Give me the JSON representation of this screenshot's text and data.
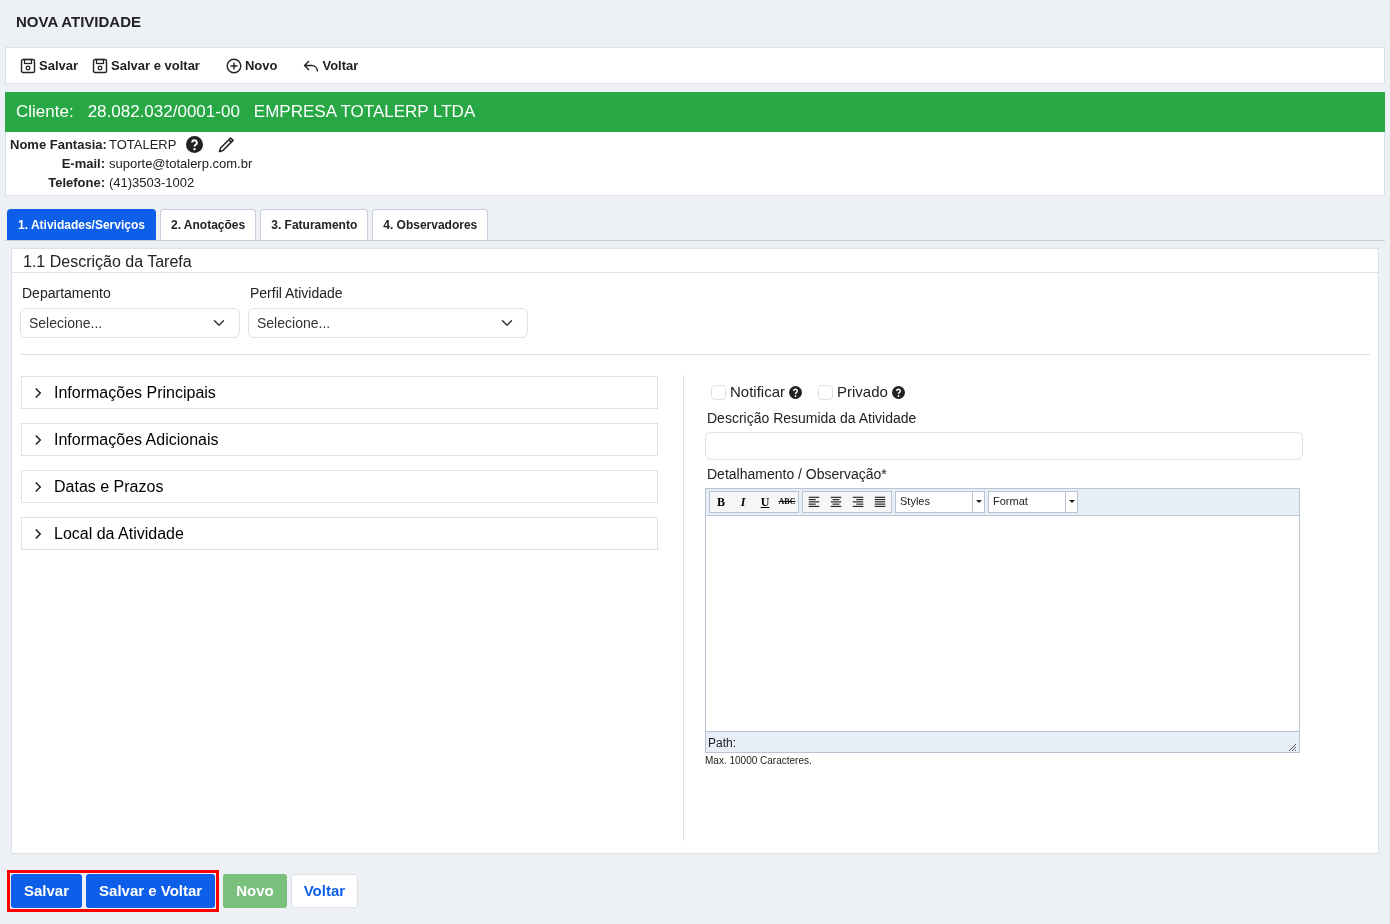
{
  "page_title": "NOVA ATIVIDADE",
  "toolbar": [
    {
      "label": "Salvar",
      "kind": "save"
    },
    {
      "label": "Salvar e voltar",
      "kind": "save"
    },
    {
      "label": "Novo",
      "kind": "add"
    },
    {
      "label": "Voltar",
      "kind": "back"
    }
  ],
  "client": {
    "label": "Cliente:",
    "document": "28.082.032/0001-00",
    "name": "EMPRESA TOTALERP LTDA"
  },
  "client_details": [
    {
      "label": "Nome Fantasia:",
      "value": "TOTALERP",
      "kind": "name"
    },
    {
      "label": "E-mail:",
      "value": "suporte@totalerp.com.br",
      "kind": "plain"
    },
    {
      "label": "Telefone:",
      "value": "(41)3503-1002",
      "kind": "plain"
    }
  ],
  "tabs": [
    {
      "label": "1. Atividades/Serviços",
      "selected": true
    },
    {
      "label": "2. Anotações",
      "selected": false
    },
    {
      "label": "3. Faturamento",
      "selected": false
    },
    {
      "label": "4. Observadores",
      "selected": false
    }
  ],
  "section_title": "1.1 Descrição da Tarefa",
  "selects": [
    {
      "label": "Departamento",
      "value": "Selecione..."
    },
    {
      "label": "Perfil Atividade",
      "value": "Selecione..."
    }
  ],
  "accordion": [
    {
      "title": "Informações Principais",
      "expanded": false
    },
    {
      "title": "Informações Adicionais",
      "expanded": false
    },
    {
      "title": "Datas e Prazos",
      "expanded": false
    },
    {
      "title": "Local da Atividade",
      "expanded": false
    }
  ],
  "options": [
    {
      "label": "Notificar",
      "checked": false
    },
    {
      "label": "Privado",
      "checked": false
    }
  ],
  "summary_field": {
    "label": "Descrição Resumida da Atividade"
  },
  "editor": {
    "label": "Detalhamento / Observação*",
    "format_buttons": [
      "B",
      "I",
      "U",
      "ABC"
    ],
    "dropdowns": [
      "Styles",
      "Format"
    ],
    "path_label": "Path:",
    "note": "Max. 10000 Caracteres."
  },
  "footer_buttons": [
    {
      "label": "Salvar",
      "kind": "primary",
      "highlighted": true
    },
    {
      "label": "Salvar e Voltar",
      "kind": "primary",
      "highlighted": true
    },
    {
      "label": "Novo",
      "kind": "success",
      "highlighted": false
    },
    {
      "label": "Voltar",
      "kind": "light",
      "highlighted": false
    }
  ]
}
